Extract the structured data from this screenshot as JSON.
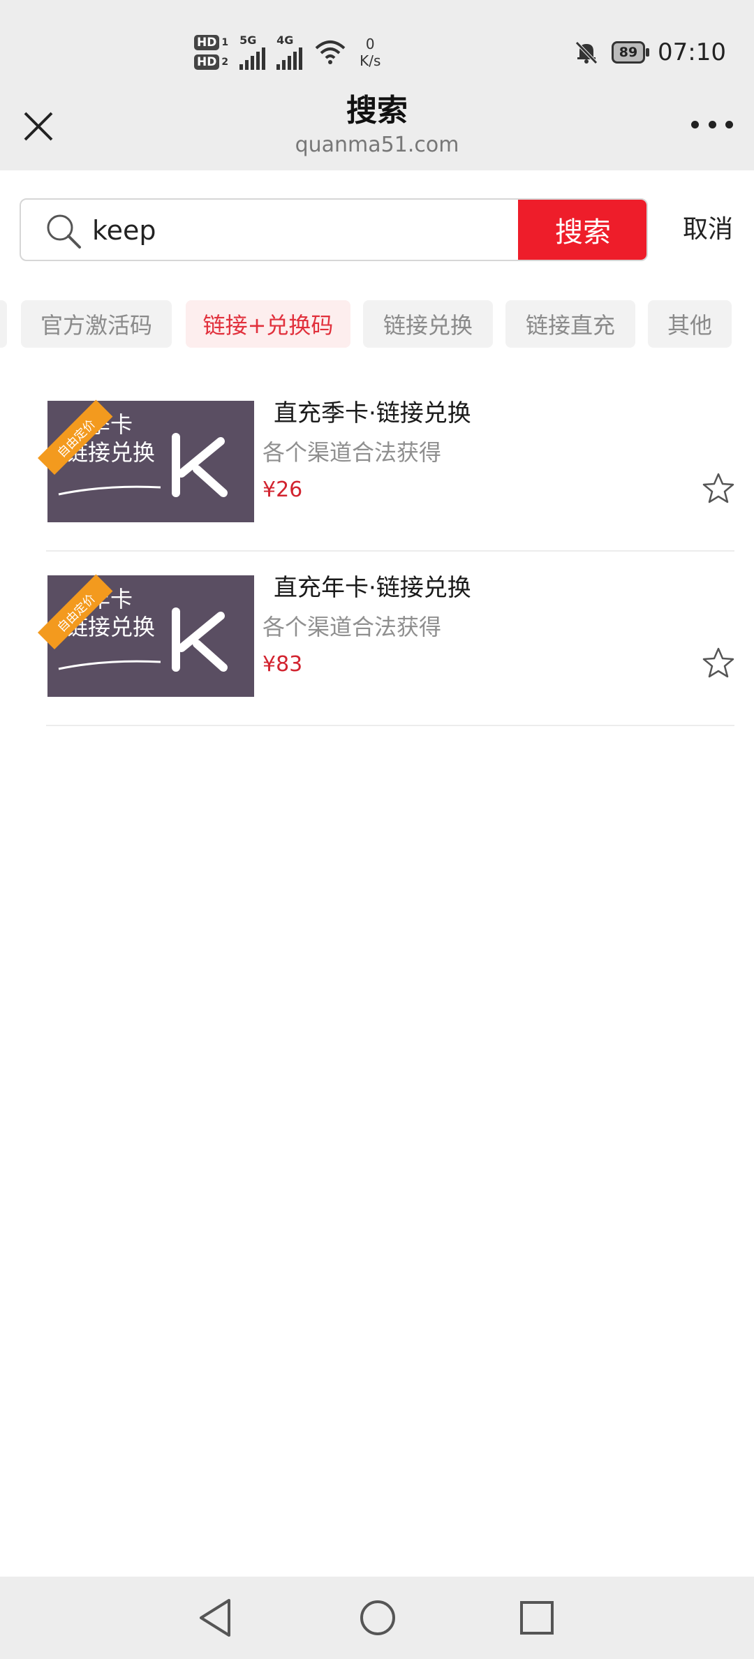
{
  "status_bar": {
    "hd1": "HD",
    "hd1_num": "1",
    "hd2": "HD",
    "hd2_num": "2",
    "net1": "5G",
    "net2": "4G",
    "speed_value": "0",
    "speed_unit": "K/s",
    "battery": "89",
    "time": "07:10"
  },
  "header": {
    "title": "搜索",
    "domain": "quanma51.com"
  },
  "search": {
    "value": "keep",
    "button_label": "搜索",
    "cancel_label": "取消"
  },
  "tags": [
    {
      "label": "官方激活码",
      "active": false
    },
    {
      "label": "链接+兑换码",
      "active": true
    },
    {
      "label": "链接兑换",
      "active": false
    },
    {
      "label": "链接直充",
      "active": false
    },
    {
      "label": "其他",
      "active": false
    }
  ],
  "products": [
    {
      "thumb_line1": "季卡",
      "thumb_line2": "链接兑换",
      "ribbon": "自由定价",
      "title": "直充季卡·链接兑换",
      "subtitle": "各个渠道合法获得",
      "price": "¥26"
    },
    {
      "thumb_line1": "年卡",
      "thumb_line2": "链接兑换",
      "ribbon": "自由定价",
      "title": "直充年卡·链接兑换",
      "subtitle": "各个渠道合法获得",
      "price": "¥83"
    }
  ],
  "colors": {
    "accent": "#ee1d2a",
    "price": "#d2232f",
    "thumb_bg": "#5a4e62",
    "ribbon": "#f39a1e"
  }
}
